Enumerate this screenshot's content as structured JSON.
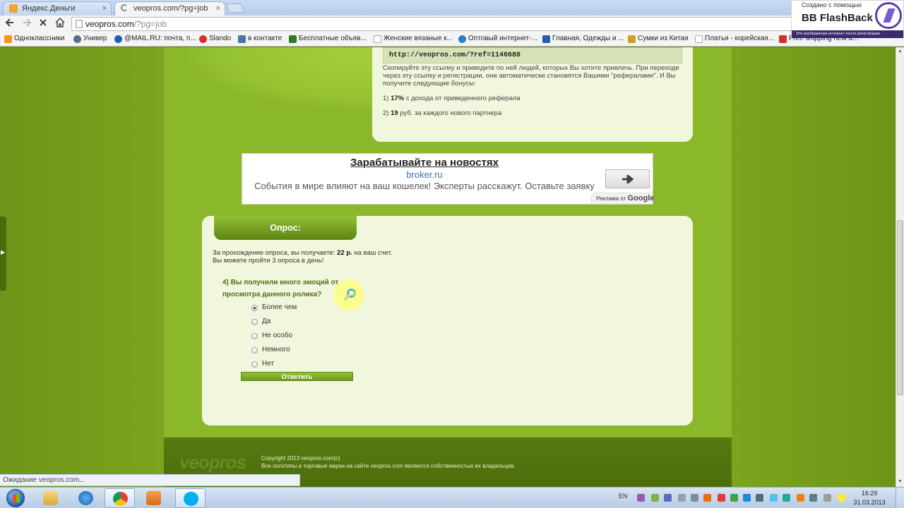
{
  "browser": {
    "tabs": [
      {
        "label": "Яндекс.Деньги",
        "active": false
      },
      {
        "label": "veopros.com/?pg=job",
        "active": true
      }
    ],
    "url": {
      "host": "veopros.com",
      "path": "/?pg=job"
    },
    "bookmarks": [
      {
        "label": "Одноклассники",
        "icon": "odnoklassniki-icon",
        "color": "#f7931e"
      },
      {
        "label": "Универ",
        "icon": "moon-icon",
        "color": "#5a6d8a"
      },
      {
        "label": "@MAIL.RU: почта, п...",
        "icon": "mail-icon",
        "color": "#1f5fb5"
      },
      {
        "label": "Slando",
        "icon": "slando-icon",
        "color": "#d92c2c"
      },
      {
        "label": "в контакте",
        "icon": "vk-icon",
        "color": "#4a76a8"
      },
      {
        "label": "Бесплатные объяв...",
        "icon": "ad-icon",
        "color": "#2d7a2d"
      },
      {
        "label": "Женские вязаные к...",
        "icon": "page-icon",
        "color": "#cfcfcf"
      },
      {
        "label": "Оптовый интернет-...",
        "icon": "wholesale-icon",
        "color": "#2a7fc1"
      },
      {
        "label": "Главная, Одежды и ...",
        "icon": "td-icon",
        "color": "#2a5bb0"
      },
      {
        "label": "Сумки из Китая",
        "icon": "rt-icon",
        "color": "#c9a227"
      },
      {
        "label": "Платья - корейская...",
        "icon": "page-icon",
        "color": "#cfcfcf"
      },
      {
        "label": "Free shipping new a...",
        "icon": "gift-icon",
        "color": "#d32f2f"
      }
    ],
    "status": "Ожидание veopros.com..."
  },
  "watermark": {
    "top": "Создано с помощью",
    "main": "BB FlashBack",
    "bar": "Это изображение исчезнет после регистрации"
  },
  "referral": {
    "link": "http://veopros.com/?ref=1146688",
    "description": "Скопируйте эту ссылку и приведите по ней людей, которых Вы хотите привлечь. При переходе через эту ссылку и регистрации, они автоматически становятся Вашими \"рефералами\". И Вы получите следующие бонусы:",
    "bonus1_prefix": "1)",
    "bonus1_value": "17%",
    "bonus1_text": "с дохода от приведенного реферала",
    "bonus2_prefix": "2)",
    "bonus2_value": "19",
    "bonus2_text": "руб. за каждого нового партнера"
  },
  "ad": {
    "title": "Зарабатывайте на новостях",
    "domain": "broker.ru",
    "text": "События в мире влияют на ваш кошелек! Эксперты расскажут. Оставьте заявку",
    "tag_prefix": "Реклама от",
    "tag_brand": "Google"
  },
  "survey": {
    "tab_label": "Опрос:",
    "info_prefix": "За прохождение опроса, вы получаете:",
    "info_amount": "22 р.",
    "info_suffix": "на ваш счет.",
    "info_line2": "Вы можете пройти 3 опроса в день!",
    "question": "4) Вы получили много эмоций от просмотра данного ролика?",
    "options": [
      {
        "label": "Более чем",
        "checked": true
      },
      {
        "label": "Да",
        "checked": false
      },
      {
        "label": "Не особо",
        "checked": false
      },
      {
        "label": "Немного",
        "checked": false
      },
      {
        "label": "Нет",
        "checked": false
      }
    ],
    "submit_label": "Ответить"
  },
  "footer": {
    "logo": "veopros",
    "copyright": "Copyright 2013 veopros.com(c)",
    "rights": "Все логотипы и торговые марки на сайте veopros.com являются собственностью их владельцев."
  },
  "taskbar": {
    "lang": "EN",
    "time": "16:29",
    "date": "31.03.2013"
  },
  "colors": {
    "page_green": "#8bb82a",
    "panel_bg": "#f1f7dc",
    "accent_dark_green": "#5c8612",
    "ad_link_blue": "#3b6fb5"
  }
}
